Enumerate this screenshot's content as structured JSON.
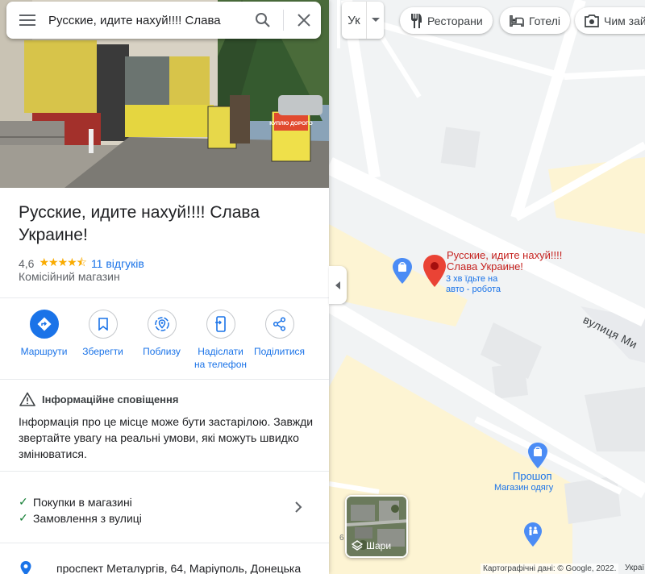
{
  "search": {
    "query": "Русские, идите нахуй!!!! Слава"
  },
  "place": {
    "title": "Русские, идите нахуй!!!! Слава Украине!",
    "rating": "4,6",
    "stars": "★★★★⯪",
    "reviews": "11 відгуків",
    "category": "Комісійний магазин"
  },
  "photo_signs": {
    "left_sign": "КУПЛЮ ДОРОГО"
  },
  "actions": [
    {
      "label": "Маршрути",
      "icon": "directions-icon"
    },
    {
      "label": "Зберегти",
      "icon": "bookmark-icon"
    },
    {
      "label": "Поблизу",
      "icon": "nearby-icon"
    },
    {
      "label": "Надіслати на телефон",
      "icon": "send-to-phone-icon"
    },
    {
      "label": "Поділитися",
      "icon": "share-icon"
    }
  ],
  "alert": {
    "title": "Інформаційне сповіщення",
    "body": "Інформація про це місце може бути застарілою. Завжди звертайте увагу на реальні умови, які можуть швидко змінюватися."
  },
  "features": [
    "Покупки в магазині",
    "Замовлення з вулиці"
  ],
  "address": "проспект Металургів, 64, Маріуполь, Донецька",
  "map": {
    "lang_button": "Ук",
    "chips": [
      "Ресторани",
      "Готелі",
      "Чим зай"
    ],
    "marker_label": [
      "Русские, идите нахуй!!!!",
      "Слава Украине!"
    ],
    "marker_sub": [
      "3 хв їдьте на",
      "авто - робота"
    ],
    "street": "вулиця Ми",
    "shop_name": "Прошоп",
    "shop_category": "Магазин одягу",
    "layers_label": "Шари",
    "side_number": "6",
    "attribution": "Картографічні дані: © Google, 2022.",
    "attribution_right": "Украї"
  },
  "colors": {
    "accent": "#1a73e8",
    "marker": "#ea4335",
    "star": "#f9ab00",
    "check": "#188038"
  }
}
